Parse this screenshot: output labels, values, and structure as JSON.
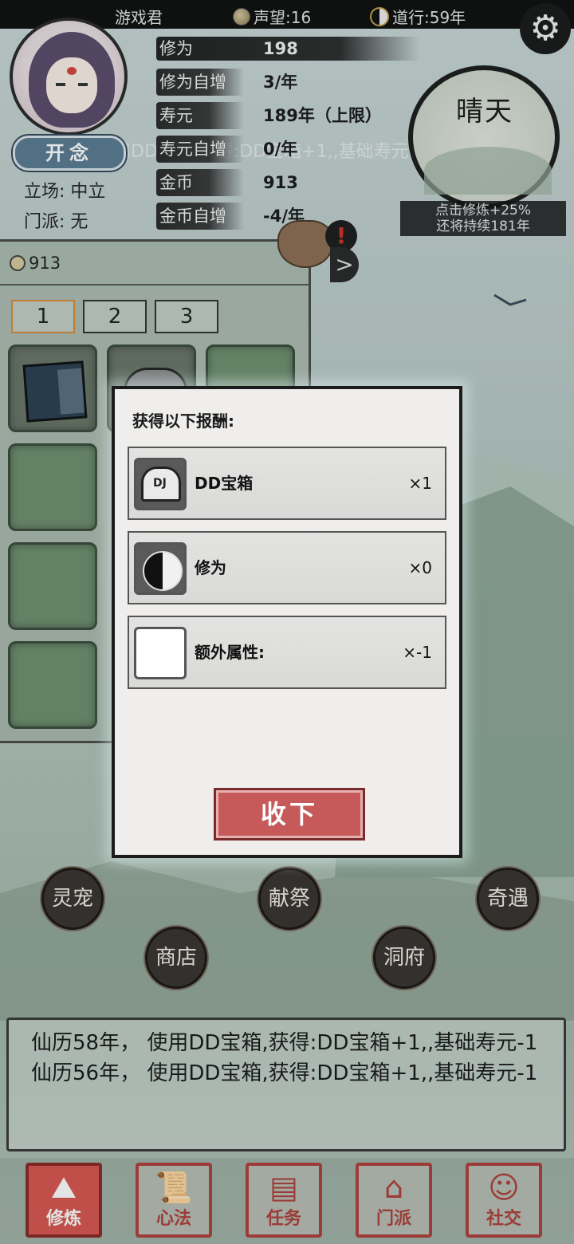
{
  "topbar": {
    "player_name": "游戏君",
    "fame": "声望:16",
    "dao": "道行:59年"
  },
  "profile": {
    "kainian_label": "开念",
    "stance": "立场: 中立",
    "sect": "门派: 无"
  },
  "marquee": "使用DD宝箱,获得:DD宝箱+1,,基础寿元-1",
  "stats": [
    {
      "label": "修为",
      "value": "198"
    },
    {
      "label": "修为自增",
      "value": "3/年"
    },
    {
      "label": "寿元",
      "value": "189年（上限）"
    },
    {
      "label": "寿元自增",
      "value": "0/年"
    },
    {
      "label": "金币",
      "value": "913"
    },
    {
      "label": "金币自增",
      "value": "-4/年"
    }
  ],
  "weather": {
    "label": "晴天",
    "info_line1": "点击修炼+25%",
    "info_line2": "还将持续181年"
  },
  "bag": {
    "alert": "!",
    "arrow": ">"
  },
  "inventory": {
    "coins": "913",
    "tabs": [
      "1",
      "2",
      "3"
    ]
  },
  "dialog": {
    "title": "获得以下报酬:",
    "rewards": [
      {
        "name": "DD宝箱",
        "qty": "×1"
      },
      {
        "name": "修为",
        "qty": "×0"
      },
      {
        "name": "额外属性:",
        "qty": "×-1"
      }
    ],
    "collect_label": "收下"
  },
  "actions": {
    "pet": "灵宠",
    "sacrifice": "献祭",
    "adventure": "奇遇",
    "shop": "商店",
    "cave": "洞府"
  },
  "log": [
    "仙历58年， 使用DD宝箱,获得:DD宝箱+1,,基础寿元-1",
    "仙历56年， 使用DD宝箱,获得:DD宝箱+1,,基础寿元-1"
  ],
  "nav": [
    {
      "label": "修炼",
      "icon": "mountain-icon"
    },
    {
      "label": "心法",
      "icon": "scroll-icon"
    },
    {
      "label": "任务",
      "icon": "quest-icon"
    },
    {
      "label": "门派",
      "icon": "sect-icon"
    },
    {
      "label": "社交",
      "icon": "social-icon"
    }
  ],
  "colors": {
    "accent_red": "#c65a5a",
    "nav_red": "#b0403c",
    "dark": "#1b1b1b"
  },
  "icons": {
    "settings": "gear-icon",
    "fame": "coin-icon",
    "dao": "yin-yang-icon",
    "reward_chest": "chest-icon",
    "reward_cultivation": "yin-yang-icon"
  }
}
